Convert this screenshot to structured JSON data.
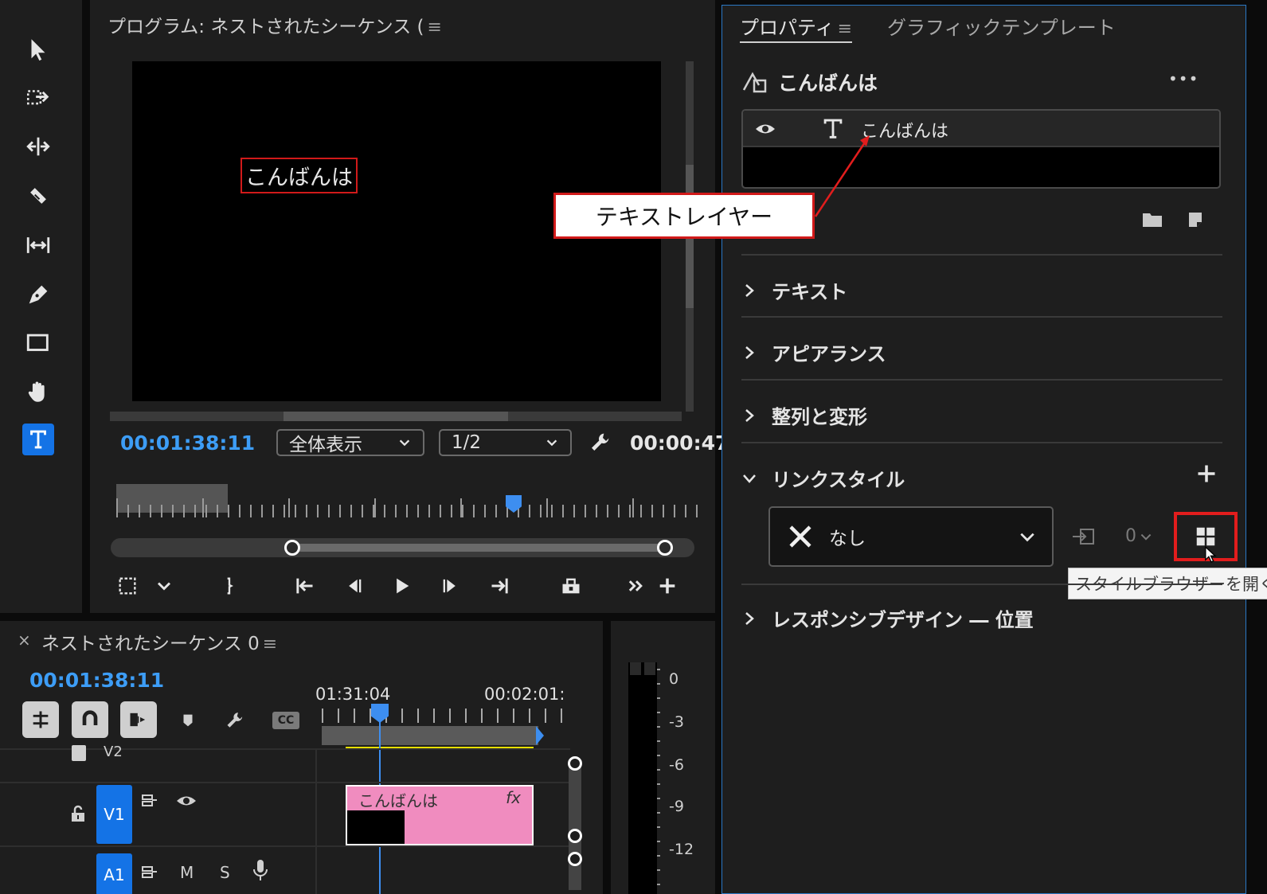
{
  "program": {
    "title": "プログラム: ネストされたシーケンス (",
    "menu_glyph": "≡",
    "caption_text": "こんばんは",
    "timecode": "00:01:38:11",
    "fit_select": "全体表示",
    "resolution_select": "1/2",
    "duration": "00:00:47"
  },
  "callout": {
    "text": "テキストレイヤー"
  },
  "timeline": {
    "close_glyph": "×",
    "title": "ネストされたシーケンス 0",
    "menu_glyph": "≡",
    "timecode": "00:01:38:11",
    "ruler_label_1": "01:31:04",
    "ruler_label_2": "00:02:01:",
    "track_v2": "V2",
    "track_v1": "V1",
    "track_a1": "A1",
    "mute": "M",
    "solo": "S",
    "clip_name": "こんばんは",
    "clip_fx": "fx",
    "captions_label": "CC"
  },
  "meters": {
    "scale": [
      "0",
      "-3",
      "-6",
      "-9",
      "-12"
    ]
  },
  "properties": {
    "tab_active": "プロパティ",
    "tab_menu_glyph": "≡",
    "tab_other": "グラフィックテンプレート",
    "graphic_name": "こんばんは",
    "more_glyph": "•••",
    "layer_name": "こんばんは",
    "sections": {
      "text": "テキスト",
      "appearance": "アピアランス",
      "align": "整列と変形",
      "linked_style": "リンクスタイル",
      "responsive": "レスポンシブデザイン ― 位置"
    },
    "style_value": "なし",
    "style_count": "0",
    "tooltip": "スタイルブラウザーを開く"
  },
  "colors": {
    "accent": "#1473e6",
    "timecode": "#3d9df6",
    "highlight": "#d11a1a",
    "clip": "#f08cbf",
    "track_target": "#e8e000"
  }
}
